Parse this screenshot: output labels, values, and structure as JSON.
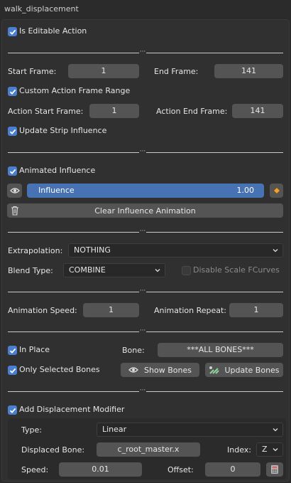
{
  "title": "walk_displacement",
  "is_editable": {
    "label": "Is Editable Action",
    "checked": true
  },
  "start_frame": {
    "label": "Start Frame:",
    "value": "1"
  },
  "end_frame": {
    "label": "End Frame:",
    "value": "141"
  },
  "custom_range": {
    "label": "Custom Action Frame Range",
    "checked": true
  },
  "action_start": {
    "label": "Action Start Frame:",
    "value": "1"
  },
  "action_end": {
    "label": "Action End Frame:",
    "value": "141"
  },
  "update_strip": {
    "label": "Update Strip Influence",
    "checked": true
  },
  "animated_influence": {
    "label": "Animated Influence",
    "checked": true
  },
  "influence": {
    "label": "Influence",
    "value": "1.00",
    "fraction": 1.0
  },
  "clear_influence_label": "Clear Influence Animation",
  "extrapolation": {
    "label": "Extrapolation:",
    "value": "NOTHING"
  },
  "blend_type": {
    "label": "Blend Type:",
    "value": "COMBINE"
  },
  "disable_scale": {
    "label": "Disable Scale FCurves",
    "checked": false
  },
  "anim_speed": {
    "label": "Animation Speed:",
    "value": "1"
  },
  "anim_repeat": {
    "label": "Animation Repeat:",
    "value": "1"
  },
  "in_place": {
    "label": "In Place",
    "checked": true
  },
  "bone": {
    "label": "Bone:",
    "value": "***ALL BONES***"
  },
  "only_selected": {
    "label": "Only Selected Bones",
    "checked": true
  },
  "show_bones_label": "Show Bones",
  "update_bones_label": "Update Bones",
  "add_displacement": {
    "label": "Add Displacement Modifier",
    "checked": true
  },
  "type": {
    "label": "Type:",
    "value": "Linear"
  },
  "displaced_bone": {
    "label": "Displaced Bone:",
    "value": "c_root_master.x"
  },
  "index": {
    "label": "Index:",
    "value": "Z"
  },
  "speed": {
    "label": "Speed:",
    "value": "0.01"
  },
  "offset": {
    "label": "Offset:",
    "value": "0"
  },
  "colors": {
    "accent": "#4772b3",
    "checkbox": "#4a7fd0",
    "keyframe": "#e8a33a"
  }
}
